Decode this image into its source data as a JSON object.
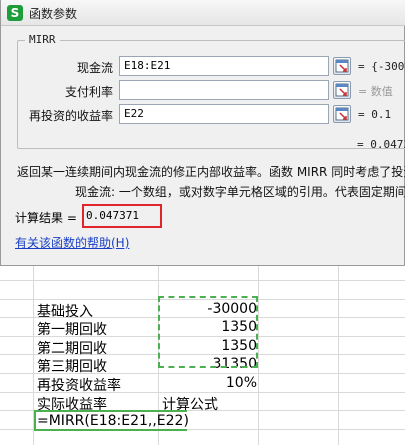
{
  "dialog": {
    "title": "函数参数",
    "function_name": "MIRR",
    "args": [
      {
        "label": "现金流",
        "value": "E18:E21",
        "result": "= {-3000"
      },
      {
        "label": "支付利率",
        "value": "",
        "result": "= 数值"
      },
      {
        "label": "再投资的收益率",
        "value": "E22",
        "result": "= 0.1"
      }
    ],
    "formula_result": "= 0.0473",
    "description": "返回某一连续期间内现金流的修正内部收益率。函数 MIRR 同时考虑了投资",
    "arg_description": "现金流:  一个数组，或对数字单元格区域的引用。代表固定期间",
    "calc_result_label": "计算结果 =",
    "calc_result_value": "0.047371",
    "help_link": "有关该函数的帮助(H)"
  },
  "sheet": {
    "rows": [
      {
        "label": "基础投入",
        "value": "-30000"
      },
      {
        "label": "第一期回收",
        "value": "1350"
      },
      {
        "label": "第二期回收",
        "value": "1350"
      },
      {
        "label": "第三期回收",
        "value": "31350"
      },
      {
        "label": "再投资收益率",
        "value": "10%"
      },
      {
        "label": "实际收益率",
        "value": "计算公式"
      }
    ],
    "editing_formula": "=MIRR(E18:E21,,E22)"
  }
}
